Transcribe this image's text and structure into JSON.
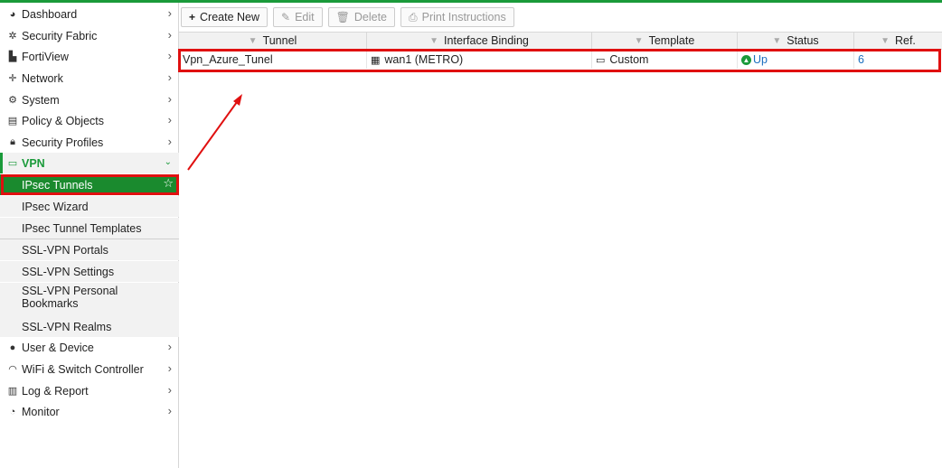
{
  "sidebar": {
    "items": [
      {
        "label": "Dashboard",
        "icon": "dashboard-icon"
      },
      {
        "label": "Security Fabric",
        "icon": "fabric-icon"
      },
      {
        "label": "FortiView",
        "icon": "chart-icon"
      },
      {
        "label": "Network",
        "icon": "network-icon"
      },
      {
        "label": "System",
        "icon": "gear-icon"
      },
      {
        "label": "Policy & Objects",
        "icon": "policy-icon"
      },
      {
        "label": "Security Profiles",
        "icon": "lock-icon"
      },
      {
        "label": "VPN",
        "icon": "laptop-icon"
      },
      {
        "label": "User & Device",
        "icon": "user-icon"
      },
      {
        "label": "WiFi & Switch Controller",
        "icon": "wifi-icon"
      },
      {
        "label": "Log & Report",
        "icon": "bar-chart-icon"
      },
      {
        "label": "Monitor",
        "icon": "pie-chart-icon"
      }
    ],
    "vpn_sub": [
      "IPsec Tunnels",
      "IPsec Wizard",
      "IPsec Tunnel Templates",
      "SSL-VPN Portals",
      "SSL-VPN Settings",
      "SSL-VPN Personal Bookmarks",
      "SSL-VPN Realms"
    ]
  },
  "toolbar": {
    "create_new": "Create New",
    "edit": "Edit",
    "delete": "Delete",
    "print": "Print Instructions"
  },
  "table": {
    "headers": [
      "Tunnel",
      "Interface Binding",
      "Template",
      "Status",
      "Ref."
    ],
    "rows": [
      {
        "tunnel": "Vpn_Azure_Tunel",
        "interface": "wan1 (METRO)",
        "template": "Custom",
        "status": "Up",
        "ref": "6"
      }
    ]
  },
  "colors": {
    "accent": "#1a9a3a",
    "highlight": "#e01010",
    "link": "#1a6fbf"
  }
}
